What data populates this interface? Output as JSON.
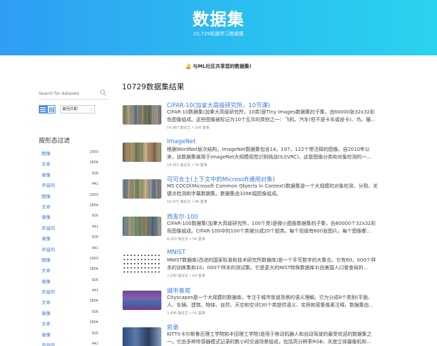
{
  "hero": {
    "title": "数据集",
    "subtitle": "10,729机器学习数据集"
  },
  "banner": {
    "icon": "bell-icon",
    "text": "与ML社区共享您的数据集!"
  },
  "sidebar": {
    "search_placeholder": "Search for datasets",
    "sort_label": "最佳匹配",
    "filter_title": "按形态过滤",
    "facets": [
      {
        "label": "图像",
        "count": "2903"
      },
      {
        "label": "文本",
        "count": "2804"
      },
      {
        "label": "录像",
        "count": "926"
      },
      {
        "label": "声音的",
        "count": "441"
      },
      {
        "label": "图像",
        "count": "2903"
      },
      {
        "label": "文本",
        "count": "2804"
      },
      {
        "label": "录像",
        "count": "926"
      },
      {
        "label": "声音的",
        "count": "441"
      },
      {
        "label": "录像",
        "count": "926"
      },
      {
        "label": "声音的",
        "count": "441"
      },
      {
        "label": "图像",
        "count": "2903"
      },
      {
        "label": "文本",
        "count": "2804"
      },
      {
        "label": "录像",
        "count": "926"
      },
      {
        "label": "声音的",
        "count": "441"
      },
      {
        "label": "文本",
        "count": "2804"
      },
      {
        "label": "录像",
        "count": "926"
      },
      {
        "label": "文本",
        "count": "2804"
      },
      {
        "label": "录像",
        "count": "926"
      },
      {
        "label": "声音的",
        "count": "441"
      }
    ]
  },
  "results": {
    "title": "10729数据集结果",
    "items": [
      {
        "title": "CIFAR-10(加拿大高级研究所，10节课)",
        "desc": "CIFAR-10数据集(加拿大高级研究所，10类)是Tiny Images数据集的子集，由60000张32x32彩色图像组成。这些图像被标记为10个互斥的类别之一：飞机、汽车(但不是卡车或皮卡)、鸟、猫...",
        "meta": "14,987 篇论文 • 106 基准"
      },
      {
        "title": "ImageNet",
        "desc": "根据WordNet层次结构，ImageNet数据集包含14，197，122个带注释的图像。自2010年以来，该数据集被用于ImageNet大规模视觉识别挑战(ILSVRC)，这是图像分类和对象检测的一...",
        "meta": "14,261 篇论文 • 43 基准"
      },
      {
        "title": "可可女士(上下文中的Microsoft通用对象)",
        "desc": "MS COCO(Microsoft Common Objects in Context)数据集是一个大规模的对象检测、分割、关键点检测和字幕数据集。数据集由328K幅图像组成。",
        "meta": "10,975 篇论文 • 96 基准"
      },
      {
        "title": "西发尔-100",
        "desc": "CIFAR-100数据集(加拿大高级研究所，100个类)是微小图像数据集的子集，由60000个32x32彩色图像组成。CIFAR-100中的100个类被分成20个超类。每个班级有600张图片。每个图像都...",
        "meta": "8,253 篇论文 • 56 基准"
      },
      {
        "title": "MNIST",
        "desc": "MNIST数据库(改进的国家标准和技术研究所数据库)是一个手写数字的大集合。它有60，000个样本的训练集和10，000个样本的测试集。它是更大的NIST特殊数据库3(由美国人口普查局的...",
        "meta": "7,245 篇论文 • 64 基准"
      },
      {
        "title": "城市景观",
        "desc": "Cityscapes是一个大规模的数据库，专注于城市街道场景的语义理解。它为分成8个类别(平面、人、车辆、建筑、物体、自然、天空和空)的30个类提供语义、实例和密集像素注释。数据集由...",
        "meta": "3,496 篇论文 • 55 基准"
      },
      {
        "title": "凯蒂",
        "desc": "KITTI(卡尔斯鲁厄理工学院和丰田理工学院)是用于移动机器人和自动驾驶的最受欢迎的数据集之一。它由多种传感器模式记录的数小时交通场景组成，包括高分辨率RGB、灰度立体摄像机和...",
        "meta": ""
      }
    ]
  }
}
